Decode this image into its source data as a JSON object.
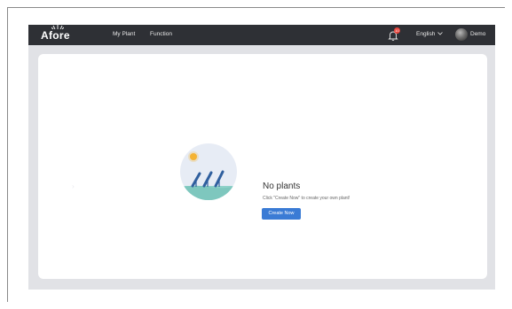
{
  "header": {
    "logo_text": "Afore",
    "nav": [
      {
        "label": "My Plant"
      },
      {
        "label": "Function"
      }
    ],
    "notification_count": "10",
    "language": "English",
    "username": "Demo"
  },
  "empty_state": {
    "title": "No plants",
    "description": "Click \"Create Now\" to create your own plant!",
    "button_label": "Create Now"
  },
  "colors": {
    "topbar": "#2e3035",
    "page_background": "#e1e2e6",
    "accent": "#3a7bd5",
    "badge": "#e8453c"
  },
  "icons": [
    "bell-icon",
    "chevron-down-icon",
    "avatar",
    "solar-plant-illustration"
  ]
}
